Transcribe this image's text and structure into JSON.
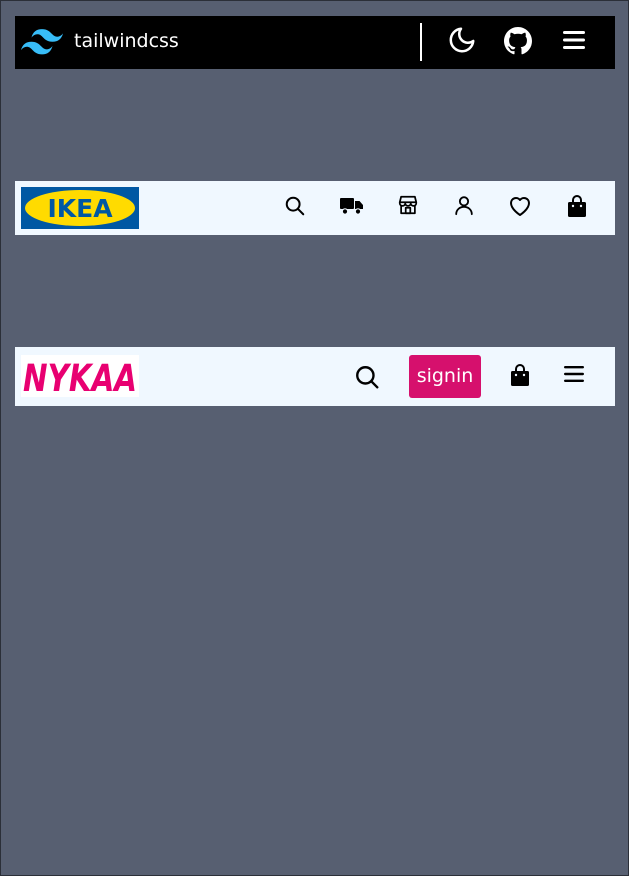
{
  "tailwind_bar": {
    "brand": "tailwindcss",
    "icons": [
      "tailwind-logo-icon",
      "moon-icon",
      "github-icon",
      "menu-icon"
    ],
    "bg": "#000000",
    "accent": "#38bdf8"
  },
  "ikea_bar": {
    "brand": "IKEA",
    "icons": [
      "search-icon",
      "truck-icon",
      "store-icon",
      "user-icon",
      "heart-icon",
      "shopping-bag-icon"
    ],
    "bg": "#f0f8ff",
    "logo_colors": {
      "blue": "#0058a3",
      "yellow": "#ffdb00"
    }
  },
  "nykaa_bar": {
    "brand": "NYKAA",
    "signin_label": "signin",
    "icons": [
      "search-icon",
      "shopping-bag-icon",
      "menu-icon"
    ],
    "bg": "#f0f8ff",
    "brand_color": "#e80071",
    "button_color": "#d6106d"
  },
  "page": {
    "bg": "#575f71"
  }
}
